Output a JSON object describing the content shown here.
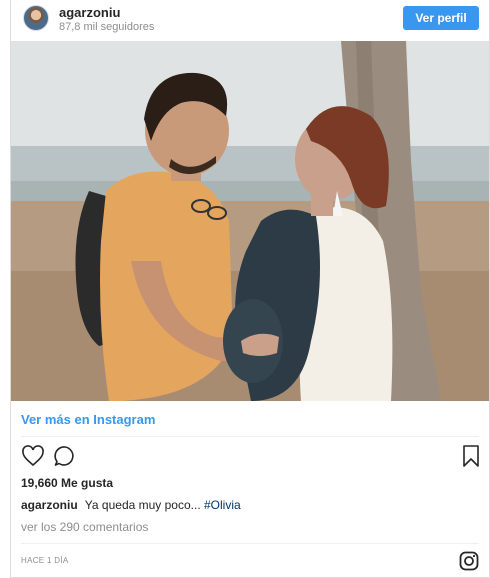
{
  "header": {
    "username": "agarzoniu",
    "followers": "87,8 mil seguidores",
    "view_profile_label": "Ver perfil"
  },
  "post": {
    "view_more_label": "Ver más en Instagram",
    "likes": "19,660 Me gusta",
    "caption_user": "agarzoniu",
    "caption_text": "Ya queda muy poco...",
    "caption_hashtag": "#Olivia",
    "comments_link": "ver los 290 comentarios",
    "timestamp": "HACE 1 DÍA"
  },
  "icons": {
    "like": "heart-icon",
    "comment": "comment-icon",
    "save": "bookmark-icon",
    "brand": "instagram-icon"
  },
  "colors": {
    "accent": "#3897f0",
    "text": "#262626",
    "muted": "#8e8e8e",
    "hashtag": "#003569"
  }
}
